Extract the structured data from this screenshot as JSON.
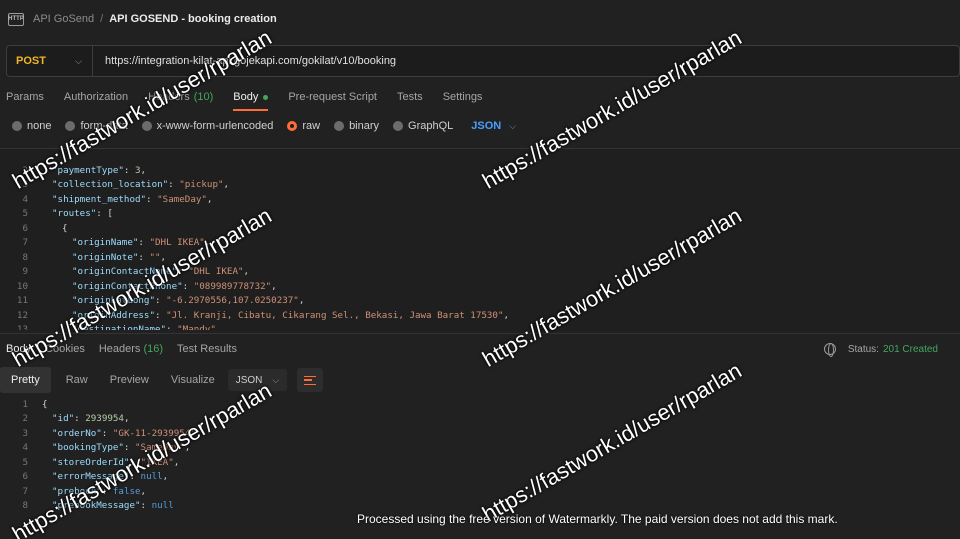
{
  "breadcrumb": {
    "icon_text": "HTTP",
    "parent": "API GoSend",
    "separator": "/",
    "current": "API GOSEND - booking creation"
  },
  "request": {
    "method": "POST",
    "url": "https://integration-kilat-api.gojekapi.com/gokilat/v10/booking"
  },
  "request_tabs": [
    {
      "label": "Params",
      "count": ""
    },
    {
      "label": "Authorization",
      "count": ""
    },
    {
      "label": "Headers",
      "count": "(10)"
    },
    {
      "label": "Body",
      "count": ""
    },
    {
      "label": "Pre-request Script",
      "count": ""
    },
    {
      "label": "Tests",
      "count": ""
    },
    {
      "label": "Settings",
      "count": ""
    }
  ],
  "body_types": [
    {
      "label": "none",
      "selected": false
    },
    {
      "label": "form-data",
      "selected": false
    },
    {
      "label": "x-www-form-urlencoded",
      "selected": false
    },
    {
      "label": "raw",
      "selected": true
    },
    {
      "label": "binary",
      "selected": false
    },
    {
      "label": "GraphQL",
      "selected": false
    }
  ],
  "body_language": "JSON",
  "request_body": [
    {
      "ln": "2",
      "key": "\"paymentType\"",
      "value": "3",
      "vtype": "n",
      "indent": 1
    },
    {
      "ln": "3",
      "key": "\"collection_location\"",
      "value": "\"pickup\"",
      "vtype": "s",
      "indent": 1
    },
    {
      "ln": "4",
      "key": "\"shipment_method\"",
      "value": "\"SameDay\"",
      "vtype": "s",
      "indent": 1
    },
    {
      "ln": "5",
      "key": "\"routes\"",
      "value": "[",
      "vtype": "p",
      "indent": 1
    },
    {
      "ln": "6",
      "key": "",
      "value": "{",
      "vtype": "p",
      "indent": 2
    },
    {
      "ln": "7",
      "key": "\"originName\"",
      "value": "\"DHL IKEA\"",
      "vtype": "s",
      "indent": 3
    },
    {
      "ln": "8",
      "key": "\"originNote\"",
      "value": "\"\"",
      "vtype": "s",
      "indent": 3
    },
    {
      "ln": "9",
      "key": "\"originContactName\"",
      "value": "\"DHL IKEA\"",
      "vtype": "s",
      "indent": 3
    },
    {
      "ln": "10",
      "key": "\"originContactPhone\"",
      "value": "\"089989778732\"",
      "vtype": "s",
      "indent": 3
    },
    {
      "ln": "11",
      "key": "\"originLatLong\"",
      "value": "\"-6.2970556,107.0250237\"",
      "vtype": "s",
      "indent": 3
    },
    {
      "ln": "12",
      "key": "\"originAddress\"",
      "value": "\"Jl. Kranji, Cibatu, Cikarang Sel., Bekasi, Jawa Barat 17530\"",
      "vtype": "s",
      "indent": 3
    },
    {
      "ln": "13",
      "key": "\"destinationName\"",
      "value": "\"Mandy\"",
      "vtype": "s",
      "indent": 3
    }
  ],
  "response_tabs": [
    {
      "label": "Body",
      "count": ""
    },
    {
      "label": "Cookies",
      "count": ""
    },
    {
      "label": "Headers",
      "count": "(16)"
    },
    {
      "label": "Test Results",
      "count": ""
    }
  ],
  "status": {
    "label": "Status:",
    "value": "201 Created"
  },
  "view_tabs": [
    "Pretty",
    "Raw",
    "Preview",
    "Visualize"
  ],
  "response_format": "JSON",
  "response_body": [
    {
      "ln": "1",
      "key": "",
      "value": "{",
      "vtype": "p",
      "indent": 0,
      "comma": false
    },
    {
      "ln": "2",
      "key": "\"id\"",
      "value": "2939954",
      "vtype": "n",
      "indent": 1,
      "comma": true
    },
    {
      "ln": "3",
      "key": "\"orderNo\"",
      "value": "\"GK-11-2939954\"",
      "vtype": "s",
      "indent": 1,
      "comma": true
    },
    {
      "ln": "4",
      "key": "\"bookingType\"",
      "value": "\"SameDay\"",
      "vtype": "s",
      "indent": 1,
      "comma": true
    },
    {
      "ln": "5",
      "key": "\"storeOrderId\"",
      "value": "\"IKEA\"",
      "vtype": "s",
      "indent": 1,
      "comma": true
    },
    {
      "ln": "6",
      "key": "\"errorMessage\"",
      "value": "null",
      "vtype": "b",
      "indent": 1,
      "comma": true
    },
    {
      "ln": "7",
      "key": "\"prebook\"",
      "value": "false",
      "vtype": "b",
      "indent": 1,
      "comma": true
    },
    {
      "ln": "8",
      "key": "\"prebookMessage\"",
      "value": "null",
      "vtype": "b",
      "indent": 1,
      "comma": false
    }
  ],
  "watermark_text": "https://fastwork.id/user/rparlan",
  "watermark_footer": "Processed using the free version of Watermarkly. The paid version does not add this mark."
}
